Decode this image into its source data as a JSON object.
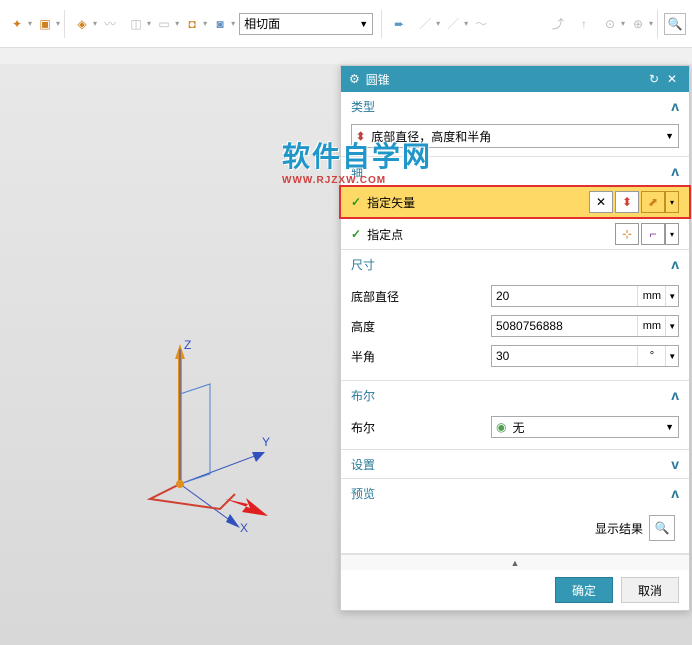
{
  "toolbar": {
    "select_label": "相切面"
  },
  "watermark": {
    "main": "软件自学网",
    "sub": "WWW.RJZXW.COM"
  },
  "panel": {
    "title": "圆锥"
  },
  "sections": {
    "type": {
      "header": "类型",
      "value": "底部直径，高度和半角"
    },
    "axis": {
      "header": "轴",
      "vector_label": "指定矢量",
      "point_label": "指定点"
    },
    "dim": {
      "header": "尺寸",
      "diameter_label": "底部直径",
      "diameter_value": "20",
      "diameter_unit": "mm",
      "height_label": "高度",
      "height_value": "5080756888",
      "height_unit": "mm",
      "halfangle_label": "半角",
      "halfangle_value": "30",
      "halfangle_unit": "°"
    },
    "bool": {
      "header": "布尔",
      "label": "布尔",
      "value": "无"
    },
    "settings": {
      "header": "设置"
    },
    "preview": {
      "header": "预览",
      "show_label": "显示结果"
    }
  },
  "axes": {
    "x": "X",
    "y": "Y",
    "z": "Z"
  },
  "footer": {
    "ok": "确定",
    "cancel": "取消"
  }
}
